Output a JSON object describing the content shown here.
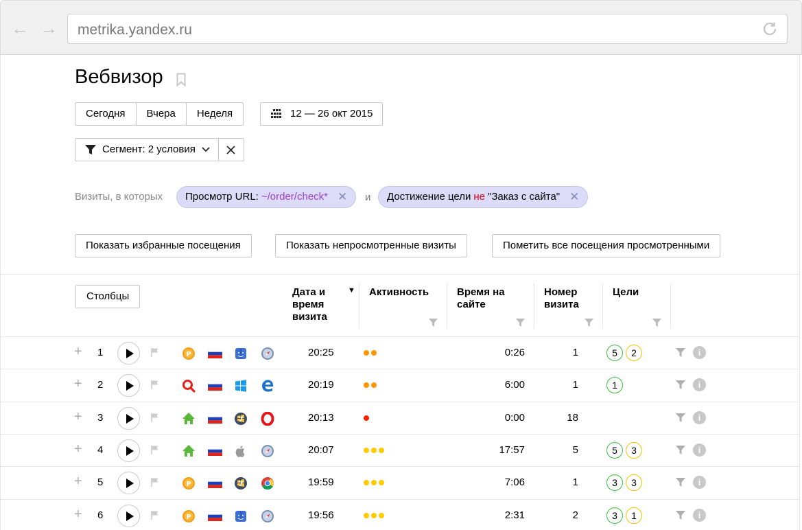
{
  "browser": {
    "url": "metrika.yandex.ru"
  },
  "page": {
    "title": "Вебвизор",
    "periods": [
      "Сегодня",
      "Вчера",
      "Неделя"
    ],
    "date_range": "12 — 26 окт 2015",
    "segment_label": "Сегмент: 2 условия",
    "visits_label": "Визиты, в которых",
    "conditions": {
      "c1_prefix": "Просмотр URL: ",
      "c1_value": "~/order/check*",
      "and": "и",
      "c2_prefix": "Достижение цели ",
      "c2_not": "не",
      "c2_suffix": " \"Заказ с сайта\""
    },
    "actions": {
      "show_favorites": "Показать избранные посещения",
      "show_unviewed": "Показать непросмотренные визиты",
      "mark_all_viewed": "Пометить все посещения просмотренными"
    },
    "columns_button": "Столбцы"
  },
  "table": {
    "headers": {
      "datetime": "Дата и время визита",
      "activity": "Активность",
      "time_on_site": "Время на сайте",
      "visit_number": "Номер визита",
      "goals": "Цели"
    },
    "rows": [
      {
        "n": "1",
        "source": "coin",
        "os": "mac",
        "browser": "safari",
        "time": "20:25",
        "activity": [
          "#ff9500",
          "#ff9500"
        ],
        "duration": "0:26",
        "visit": "1",
        "goals": [
          {
            "v": "5",
            "c": "green"
          },
          {
            "v": "2",
            "c": "yellow"
          }
        ]
      },
      {
        "n": "2",
        "source": "search",
        "os": "windows",
        "browser": "edge",
        "time": "20:19",
        "activity": [
          "#ff9500",
          "#ff9500"
        ],
        "duration": "6:00",
        "visit": "1",
        "goals": [
          {
            "v": "1",
            "c": "green"
          }
        ]
      },
      {
        "n": "3",
        "source": "direct",
        "os": "win7",
        "browser": "opera",
        "time": "20:13",
        "activity": [
          "#ff2200"
        ],
        "duration": "0:00",
        "visit": "18",
        "goals": []
      },
      {
        "n": "4",
        "source": "direct",
        "os": "apple",
        "browser": "safari",
        "time": "20:07",
        "activity": [
          "#ffcc00",
          "#ffcc00",
          "#ffcc00"
        ],
        "duration": "17:57",
        "visit": "5",
        "goals": [
          {
            "v": "5",
            "c": "green"
          },
          {
            "v": "3",
            "c": "yellow"
          }
        ]
      },
      {
        "n": "5",
        "source": "coin",
        "os": "win7",
        "browser": "chrome",
        "time": "19:59",
        "activity": [
          "#ffcc00",
          "#ffcc00",
          "#ffcc00"
        ],
        "duration": "7:06",
        "visit": "1",
        "goals": [
          {
            "v": "3",
            "c": "green"
          },
          {
            "v": "3",
            "c": "yellow"
          }
        ]
      },
      {
        "n": "6",
        "source": "coin",
        "os": "mac",
        "browser": "safari",
        "time": "19:56",
        "activity": [
          "#ffcc00",
          "#ffcc00",
          "#ffcc00"
        ],
        "duration": "2:31",
        "visit": "2",
        "goals": [
          {
            "v": "3",
            "c": "green"
          },
          {
            "v": "1",
            "c": "yellow"
          }
        ]
      }
    ]
  },
  "colors": {
    "chip_bg": "#dcdcf8",
    "purple": "#9b3fd1",
    "red": "#e0001b"
  }
}
